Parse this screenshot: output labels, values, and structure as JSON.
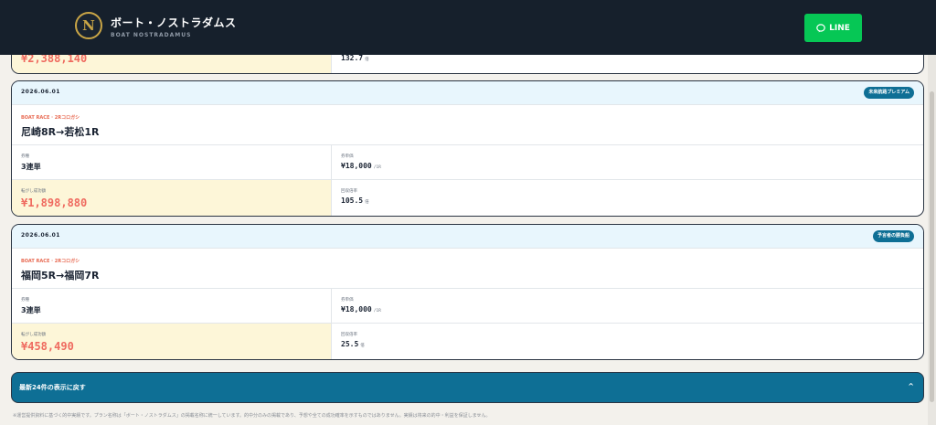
{
  "header": {
    "logo_letter": "N",
    "brand_name": "ボート・ノストラダムス",
    "brand_sub": "BOAT NOSTRADAMUS",
    "line_label": "LINE"
  },
  "top_card": {
    "amount": "¥2,388,140",
    "rate": "132.7",
    "rate_unit": "倍"
  },
  "cards": [
    {
      "date": "2026.06.01",
      "badge": "未来航路プレミアム",
      "race_label": "BOAT RACE · 2Rコロガシ",
      "race_title": "尼崎8R→若松1R",
      "bet_type_label": "券種",
      "bet_type": "3連単",
      "price_label": "券単価",
      "price": "¥18,000",
      "price_unit": "/1R",
      "win_label": "転がし成功額",
      "win_amount": "¥1,898,880",
      "rate_label": "回収倍率",
      "rate": "105.5",
      "rate_unit": "倍"
    },
    {
      "date": "2026.06.01",
      "badge": "予言者の勝負船",
      "race_label": "BOAT RACE · 2Rコロガシ",
      "race_title": "福岡5R→福岡7R",
      "bet_type_label": "券種",
      "bet_type": "3連単",
      "price_label": "券単価",
      "price": "¥18,000",
      "price_unit": "/1R",
      "win_label": "転がし成功額",
      "win_amount": "¥458,490",
      "rate_label": "回収倍率",
      "rate": "25.5",
      "rate_unit": "倍"
    }
  ],
  "back_button": {
    "label": "最新24件の表示に戻す",
    "chevron": "^"
  },
  "disclaimer": "※運営提供資料に基づく的中実績です。プラン名称は「ボート・ノストラダムス」の掲載名称に統一しています。的中分のみの掲載であり、予想や全ての成功確率を示すものではありません。実績は将来の的中・利益を保証しません。",
  "colors": {
    "header_bg": "#16202c",
    "line_green": "#06c755",
    "accent_blue": "#0e6f95",
    "amount_red": "#ef6a5f",
    "highlight_yellow": "#fdf6d8"
  }
}
